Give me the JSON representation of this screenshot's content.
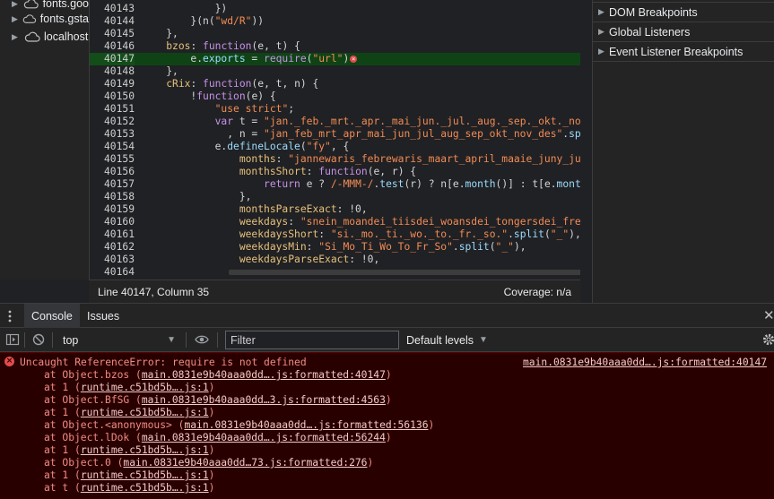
{
  "file_tree": [
    {
      "label": "fonts.goo",
      "icon": "cloud-icon"
    },
    {
      "label": "fonts.gsta",
      "icon": "cloud-icon"
    },
    {
      "label": "localhost",
      "icon": "cloud-icon"
    }
  ],
  "editor": {
    "lines": [
      {
        "n": "40143",
        "code": "            })"
      },
      {
        "n": "40144",
        "code": "        }(n(\"wd/R\"))"
      },
      {
        "n": "40145",
        "code": "    },"
      },
      {
        "n": "40146",
        "code": "    bzos: function(e, t) {"
      },
      {
        "n": "40147",
        "code": "        e.exports = require(\"url\")"
      },
      {
        "n": "40148",
        "code": "    },"
      },
      {
        "n": "40149",
        "code": "    cRix: function(e, t, n) {"
      },
      {
        "n": "40150",
        "code": "        !function(e) {"
      },
      {
        "n": "40151",
        "code": "            \"use strict\";"
      },
      {
        "n": "40152",
        "code": "            var t = \"jan._feb._mrt._apr._mai_jun._jul._aug._sep._okt._nov."
      },
      {
        "n": "40153",
        "code": "              , n = \"jan_feb_mrt_apr_mai_jun_jul_aug_sep_okt_nov_des\".spli"
      },
      {
        "n": "40154",
        "code": "            e.defineLocale(\"fy\", {"
      },
      {
        "n": "40155",
        "code": "                months: \"jannewaris_febrewaris_maart_april_maaie_juny_july"
      },
      {
        "n": "40156",
        "code": "                monthsShort: function(e, r) {"
      },
      {
        "n": "40157",
        "code": "                    return e ? /-MMM-/.test(r) ? n[e.month()] : t[e.month("
      },
      {
        "n": "40158",
        "code": "                },"
      },
      {
        "n": "40159",
        "code": "                monthsParseExact: !0,"
      },
      {
        "n": "40160",
        "code": "                weekdays: \"snein_moandei_tiisdei_woansdei_tongersdei_freed"
      },
      {
        "n": "40161",
        "code": "                weekdaysShort: \"si._mo._ti._wo._to._fr._so.\".split(\"_\"),"
      },
      {
        "n": "40162",
        "code": "                weekdaysMin: \"Si_Mo_Ti_Wo_To_Fr_So\".split(\"_\"),"
      },
      {
        "n": "40163",
        "code": "                weekdaysParseExact: !0,"
      },
      {
        "n": "40164",
        "code": ""
      }
    ],
    "highlighted_line": "40147"
  },
  "status": {
    "position": "Line 40147, Column 35",
    "coverage": "Coverage: n/a"
  },
  "right_panel": [
    {
      "label": "DOM Breakpoints"
    },
    {
      "label": "Global Listeners"
    },
    {
      "label": "Event Listener Breakpoints"
    }
  ],
  "drawer": {
    "tabs": [
      {
        "label": "Console",
        "active": true
      },
      {
        "label": "Issues",
        "active": false
      }
    ],
    "close_glyph": "✕"
  },
  "toolbar": {
    "context": "top",
    "filter_placeholder": "Filter",
    "levels": "Default levels"
  },
  "console": {
    "error": "Uncaught ReferenceError: require is not defined",
    "source": "main.0831e9b40aaa0dd….js:formatted:40147",
    "stack": [
      {
        "prefix": "at Object.bzos (",
        "link": "main.0831e9b40aaa0dd….js:formatted:40147",
        "suffix": ")"
      },
      {
        "prefix": "at 1 (",
        "link": "runtime.c51bd5b….js:1",
        "suffix": ")"
      },
      {
        "prefix": "at Object.BfSG (",
        "link": "main.0831e9b40aaa0dd…3.js:formatted:4563",
        "suffix": ")"
      },
      {
        "prefix": "at 1 (",
        "link": "runtime.c51bd5b….js:1",
        "suffix": ")"
      },
      {
        "prefix": "at Object.<anonymous> (",
        "link": "main.0831e9b40aaa0dd….js:formatted:56136",
        "suffix": ")"
      },
      {
        "prefix": "at Object.lDok (",
        "link": "main.0831e9b40aaa0dd….js:formatted:56244",
        "suffix": ")"
      },
      {
        "prefix": "at 1 (",
        "link": "runtime.c51bd5b….js:1",
        "suffix": ")"
      },
      {
        "prefix": "at Object.0 (",
        "link": "main.0831e9b40aaa0dd…73.js:formatted:276",
        "suffix": ")"
      },
      {
        "prefix": "at 1 (",
        "link": "runtime.c51bd5b….js:1",
        "suffix": ")"
      },
      {
        "prefix": "at t (",
        "link": "runtime.c51bd5b….js:1",
        "suffix": ")"
      }
    ]
  },
  "colors": {
    "highlight_line": "#0f4315",
    "error_background": "#290000",
    "error_text": "#f28b82"
  }
}
